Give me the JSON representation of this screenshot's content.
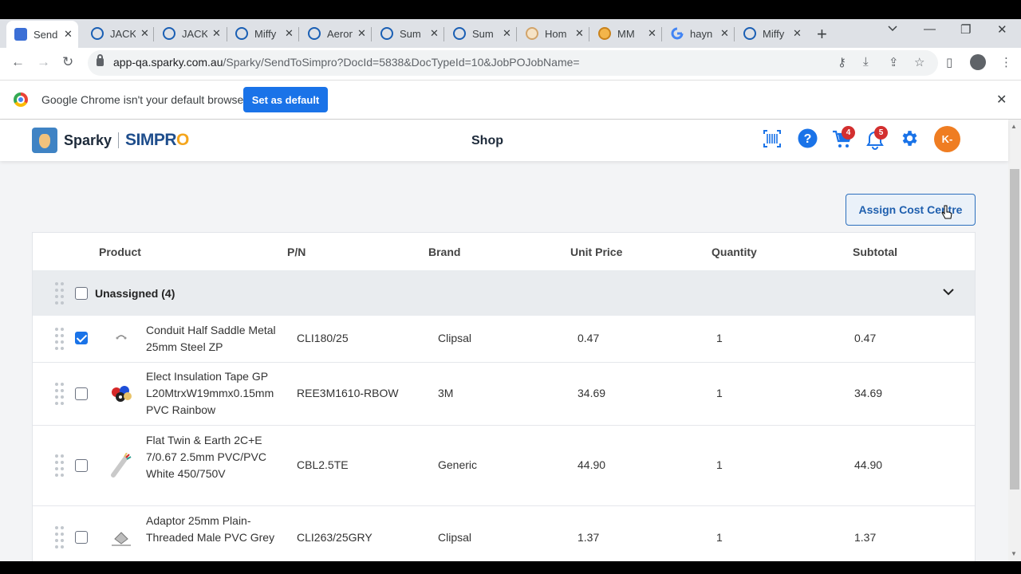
{
  "browser": {
    "tabs": [
      {
        "label": "Send",
        "icon": "sparky-favicon",
        "active": true
      },
      {
        "label": "JACK",
        "icon": "link-favicon"
      },
      {
        "label": "JACK",
        "icon": "link-favicon"
      },
      {
        "label": "Miffy",
        "icon": "link-favicon"
      },
      {
        "label": "Aeron",
        "icon": "link-favicon"
      },
      {
        "label": "Sum",
        "icon": "link-favicon"
      },
      {
        "label": "Sum",
        "icon": "link-favicon"
      },
      {
        "label": "Hom",
        "icon": "home-favicon"
      },
      {
        "label": "MM",
        "icon": "mm-favicon"
      },
      {
        "label": "hayn",
        "icon": "google-favicon"
      },
      {
        "label": "Miffy",
        "icon": "link-favicon"
      }
    ],
    "url_host": "app-qa.sparky.com.au",
    "url_path": "/Sparky/SendToSimpro?DocId=5838&DocTypeId=10&JobPOJobName=",
    "infobar_text": "Google Chrome isn't your default browser",
    "infobar_button": "Set as default"
  },
  "header": {
    "brand": "Sparky",
    "brand2_prefix": "SIMPR",
    "brand2_o": "O",
    "center_title": "Shop",
    "cart_count": "4",
    "notif_count": "5",
    "avatar_initials": "K-"
  },
  "main": {
    "assign_button": "Assign Cost Centre",
    "columns": [
      "Product",
      "P/N",
      "Brand",
      "Unit Price",
      "Quantity",
      "Subtotal"
    ],
    "group_label": "Unassigned (4)",
    "rows": [
      {
        "name": "Conduit Half Saddle Metal 25mm Steel ZP",
        "pn": "CLI180/25",
        "brand": "Clipsal",
        "unit_price": "0.47",
        "qty": "1",
        "subtotal": "0.47",
        "checked": true
      },
      {
        "name": "Elect Insulation Tape GP L20MtrxW19mmx0.15mm PVC Rainbow",
        "pn": "REE3M1610-RBOW",
        "brand": "3M",
        "unit_price": "34.69",
        "qty": "1",
        "subtotal": "34.69",
        "checked": false
      },
      {
        "name": "Flat Twin & Earth 2C+E 7/0.67 2.5mm PVC/PVC White 450/750V",
        "pn": "CBL2.5TE",
        "brand": "Generic",
        "unit_price": "44.90",
        "qty": "1",
        "subtotal": "44.90",
        "checked": false
      },
      {
        "name": "Adaptor 25mm Plain-Threaded Male PVC Grey",
        "pn": "CLI263/25GRY",
        "brand": "Clipsal",
        "unit_price": "1.37",
        "qty": "1",
        "subtotal": "1.37",
        "checked": false
      }
    ]
  }
}
